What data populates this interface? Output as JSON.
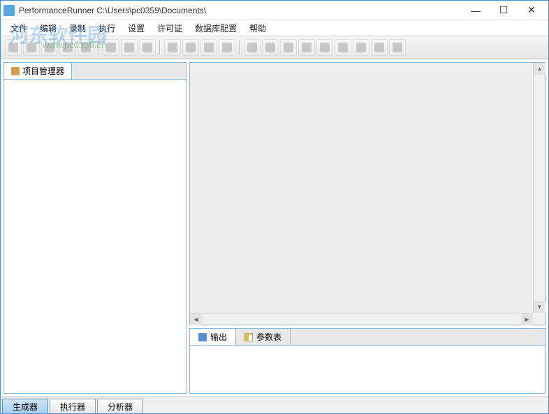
{
  "window": {
    "title": "PerformanceRunner  C:\\Users\\pc0359\\Documents\\"
  },
  "menu": {
    "items": [
      "文件",
      "编辑",
      "录制",
      "执行",
      "设置",
      "许可证",
      "数据库配置",
      "帮助"
    ]
  },
  "watermark": {
    "text1": "河东软件园",
    "text2": "www.pc0359.cn"
  },
  "left_panel": {
    "tab_label": "项目管理器"
  },
  "bottom_panel": {
    "tabs": [
      {
        "label": "输出"
      },
      {
        "label": "参数表"
      }
    ]
  },
  "status": {
    "tabs": [
      "生成器",
      "执行器",
      "分析器"
    ]
  },
  "toolbar": {
    "groups": [
      [
        "new",
        "open",
        "save",
        "stop",
        "delete"
      ],
      [
        "cut",
        "copy",
        "paste"
      ],
      [
        "check",
        "arrow",
        "flag",
        "pin"
      ],
      [
        "text",
        "inc",
        "br1",
        "br2",
        "br3",
        "br4",
        "grid",
        "br5",
        "br6"
      ]
    ]
  }
}
